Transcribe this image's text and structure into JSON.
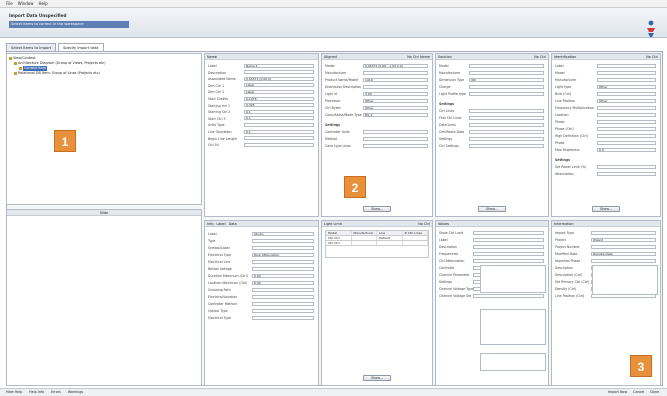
{
  "menu": [
    "File",
    "Window",
    "Help"
  ],
  "banner": {
    "title": "Import Data Unspecified",
    "subtitle": "Select items to correct in the workspace"
  },
  "tabs": [
    "Select Items to Import",
    "Specify Import data"
  ],
  "tree": {
    "items": [
      {
        "label": "View/Context",
        "level": 0,
        "selected": false
      },
      {
        "label": "Architecture Diagram (Group of Views, Projects etc)",
        "level": 1,
        "selected": false
      },
      {
        "label": "Context Item",
        "level": 2,
        "selected": true
      },
      {
        "label": "Relational DB Item: Group of Lines (Projects etc)",
        "level": 1,
        "selected": false
      }
    ]
  },
  "lower_left_header": "Slide",
  "panels": {
    "p1": {
      "title": "Name",
      "labels": [
        "Label",
        "Description",
        "Associated Name",
        "Dim Ctrl 1",
        "Dim Ctrl 2",
        "Start Credits",
        "Starting ctrl 1",
        "Starting Ctrl 2",
        "Start Ctrl 3",
        "Units Type",
        "Line Operation",
        "Begin Line Length",
        "Ctrl All"
      ],
      "values": [
        "Name 1",
        "",
        "0.05371 (0.00.0)",
        "Label",
        "Label",
        "0.1078",
        "0.325",
        "0.1",
        "0.1",
        "",
        "0.1",
        "",
        ""
      ]
    },
    "p2": {
      "title": "Aligned",
      "title_right": "No Ctrl Name",
      "labels": [
        "Model",
        "Manufacturer",
        "Product Name/Model",
        "Distributor Description",
        "Light id",
        "Processor",
        "Ctrl Bytes",
        "Color/Alpha/Mode Type"
      ],
      "values": [
        "0.05371 (0.00 - 1.03 2.0)",
        "",
        "1410",
        "",
        "3.00",
        "Other",
        "Other",
        "Blk 2"
      ],
      "sublabels": [
        "Settings",
        "Controller Units",
        "Method",
        "Color type Lines"
      ],
      "button": "Show..."
    },
    "p3": {
      "title": "Solution",
      "title_right": "No Ctrl",
      "labels": [
        "Model",
        "Manufacturer",
        "Dimension Type",
        "Charge",
        "Light Profile type"
      ],
      "values": [
        "",
        "",
        "ON",
        "",
        ""
      ],
      "sublabels": [
        "Settings",
        "Ctrl Lines",
        "First Ctrl Lines",
        "Data Lines",
        "Certificate Data",
        "Settings",
        "Ctrl Settings"
      ],
      "button": "Show..."
    },
    "p4": {
      "title": "Identification",
      "title_right": "No Ctrl",
      "labels": [
        "Label",
        "Model",
        "Manufacturer",
        "Light type",
        "Bulb (Ctrl)",
        "Line Position",
        "Frequency Multiplication",
        "Location",
        "Phase",
        "Phase (Ctrl)",
        "High Definition (Ctrl)",
        "Phase",
        "Max Brightness"
      ],
      "values": [
        "",
        "",
        "",
        "Other",
        "",
        "Other",
        "",
        "",
        "",
        "",
        "",
        "",
        "0.0"
      ],
      "sublabels": [
        "Settings",
        "Set Power Limit (%)",
        "Attenuation"
      ],
      "button": "Show..."
    },
    "p5": {
      "tabs": [
        "Info",
        "Label",
        "Data"
      ],
      "labels": [
        "Label",
        "Type",
        "Symbol/Label",
        "Electrical Type",
        "Electrical Line",
        "Ballast Voltage",
        "Duration Maximum (Ctrl)",
        "Location Maximum (Ctrl)",
        "Grouping Path",
        "Electrical/Location",
        "Controller Method",
        "Optical Type",
        "Electrical Type"
      ],
      "values": [
        "Studio",
        "",
        "",
        "Dual Attenuation",
        "",
        "",
        "0.00",
        "0.00",
        "",
        "",
        "",
        "",
        ""
      ]
    },
    "p6": {
      "title": "Light Limit",
      "title_right": "No Ctrl",
      "columns": [
        "Model",
        "Manufacturer",
        "Line",
        "# Ctrl Lines"
      ],
      "rows": [
        [
          "Ctrl Ctrl",
          "",
          "Default",
          ""
        ],
        [
          "Ctrl Ctrl",
          "",
          "",
          ""
        ]
      ],
      "button": "Show..."
    },
    "p7": {
      "title": "Values",
      "labels": [
        "Show Ctrl Limit",
        "Label",
        "Description",
        "Frequencies",
        "Ctrl Attenuation",
        "Controller",
        "Channel Parameter",
        "Settings",
        "Channel Voltage Type",
        "Channel Voltage Set"
      ],
      "values": [
        "",
        "",
        "",
        "",
        "",
        "",
        "",
        "",
        "",
        ""
      ]
    },
    "p8": {
      "title": "Information",
      "labels": [
        "Import Type",
        "Project",
        "Project Number",
        "Modified Date",
        "Imported Phase",
        "Description",
        "Description (Ctrl)",
        "Set Primary Ctrl (Ctrl)",
        "Density (Ctrl)",
        "Line Position (Ctrl)"
      ],
      "values": [
        "",
        "Wizard",
        "",
        "Remote Date",
        "",
        "",
        "",
        "",
        "",
        ""
      ]
    }
  },
  "markers": [
    "1",
    "2",
    "3"
  ],
  "status": {
    "items": [
      "Hide Help",
      "Help Info",
      "Errors",
      "Warnings"
    ],
    "right": [
      "Import Now",
      "Cancel",
      "Done"
    ]
  }
}
